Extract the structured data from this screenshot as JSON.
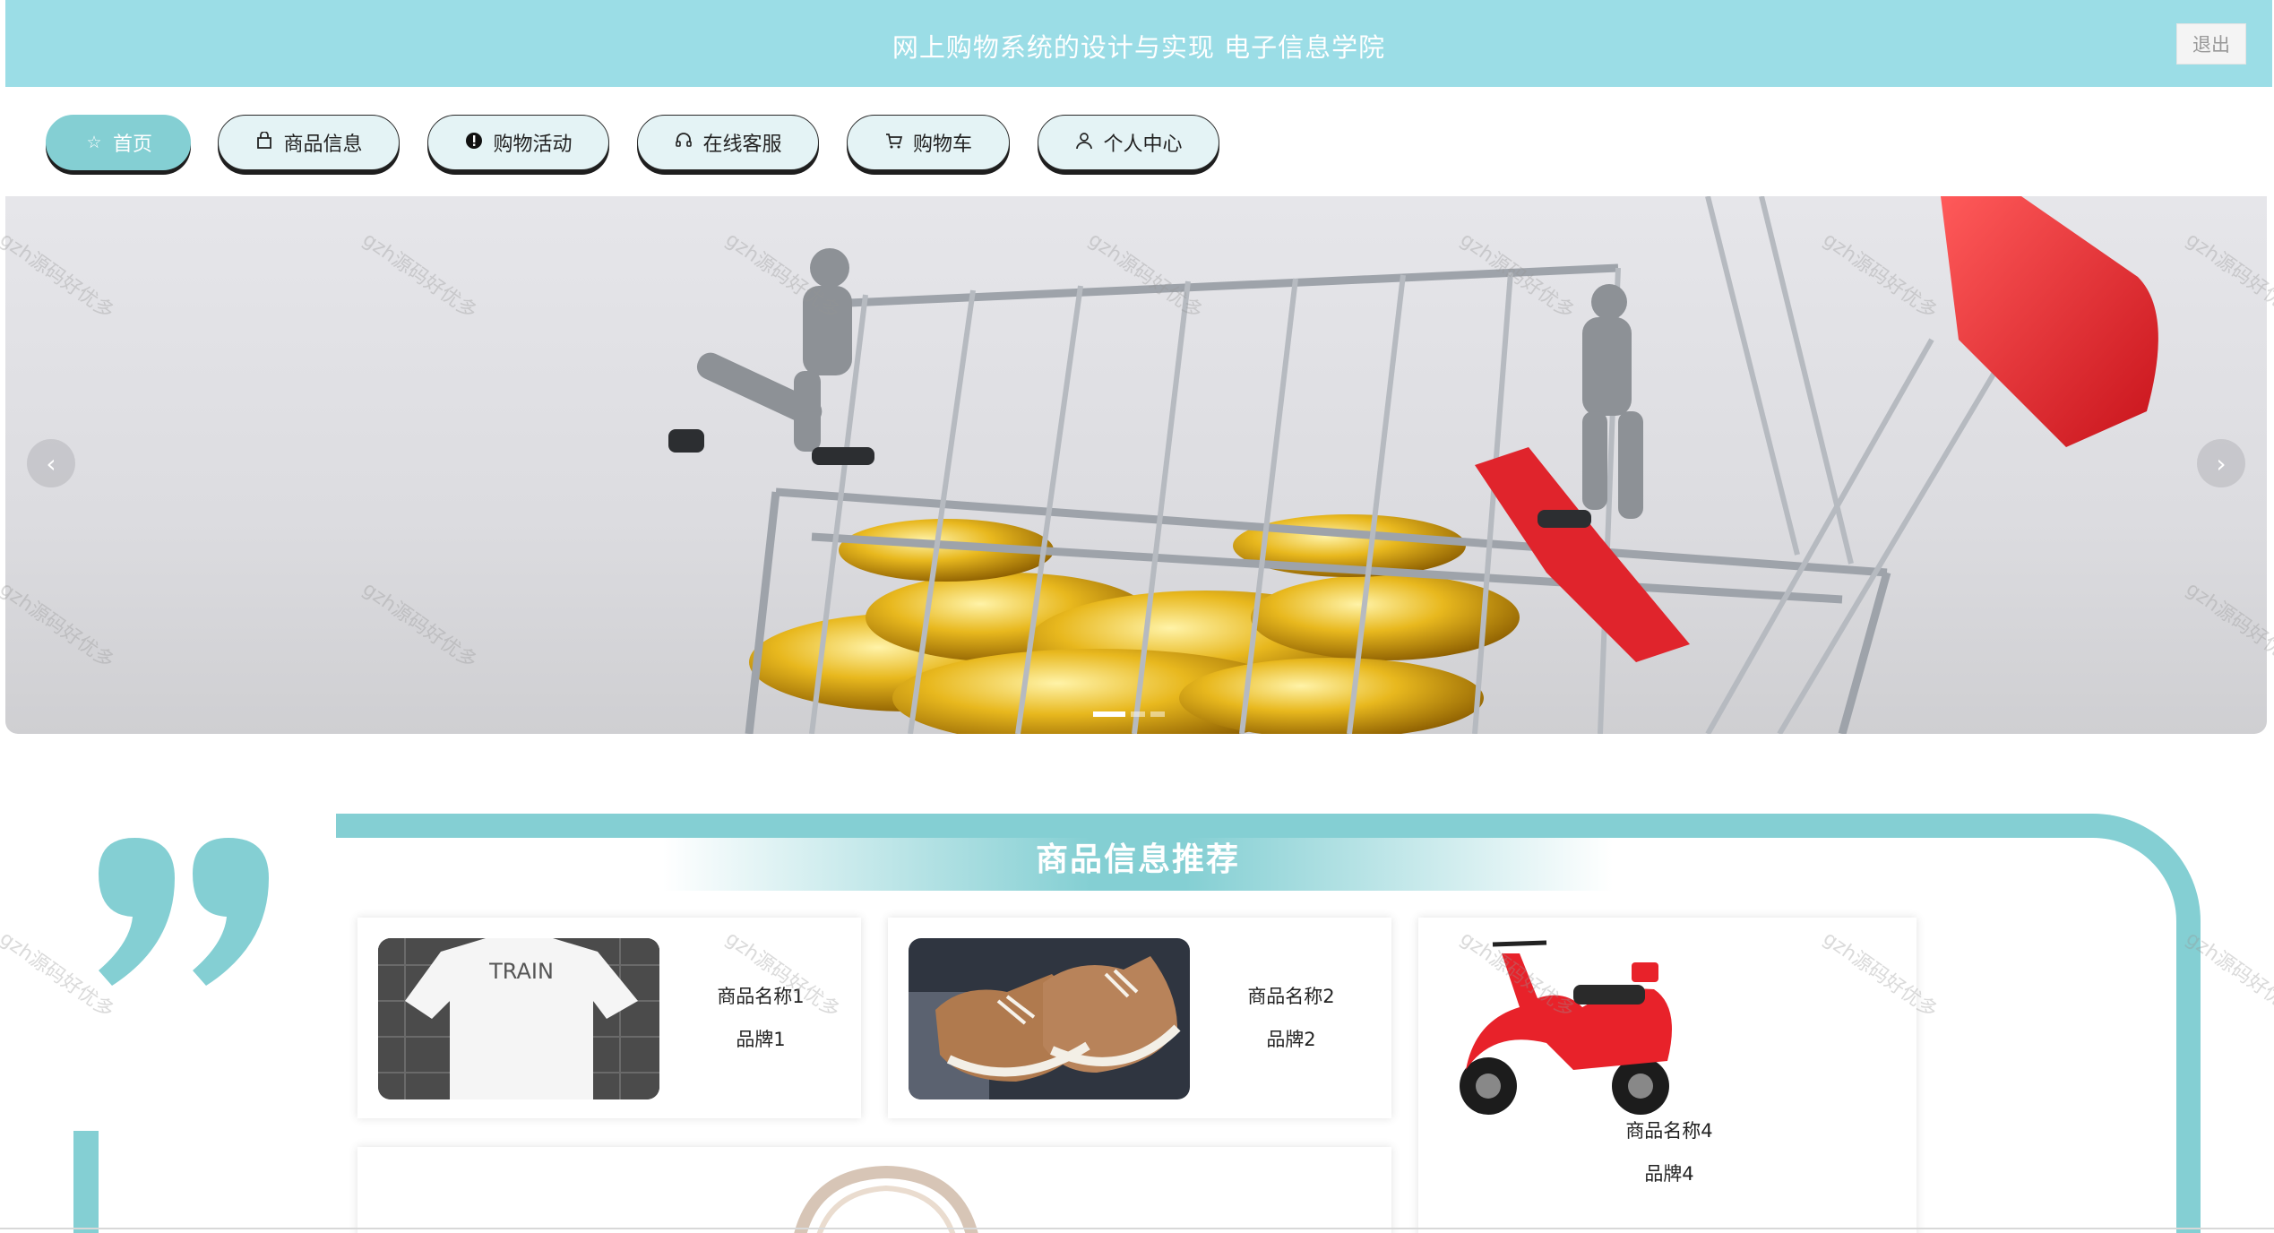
{
  "header": {
    "title": "网上购物系统的设计与实现 电子信息学院",
    "logout_label": "退出"
  },
  "nav": {
    "items": [
      {
        "label": "首页",
        "icon": "star-icon"
      },
      {
        "label": "商品信息",
        "icon": "bag-icon"
      },
      {
        "label": "购物活动",
        "icon": "alert-circle-icon"
      },
      {
        "label": "在线客服",
        "icon": "headset-icon"
      },
      {
        "label": "购物车",
        "icon": "cart-icon"
      },
      {
        "label": "个人中心",
        "icon": "user-icon"
      }
    ],
    "active_index": 0
  },
  "carousel": {
    "prev_glyph": "‹",
    "next_glyph": "›",
    "slide_count": 3,
    "active_slide": 1
  },
  "recommend": {
    "title": "商品信息推荐",
    "products": [
      {
        "name": "商品名称1",
        "brand": "品牌1",
        "image": "white-tshirt"
      },
      {
        "name": "商品名称2",
        "brand": "品牌2",
        "image": "brown-sneakers"
      },
      {
        "name": "商品名称4",
        "brand": "品牌4",
        "image": "red-scooter"
      },
      {
        "name": "",
        "brand": "",
        "image": "handbag-partial"
      }
    ]
  },
  "watermark_text": "gzh源码好优多",
  "colors": {
    "header_bg": "#9bdde6",
    "accent": "#84cfd3",
    "nav_bg": "#e4f3f5"
  }
}
